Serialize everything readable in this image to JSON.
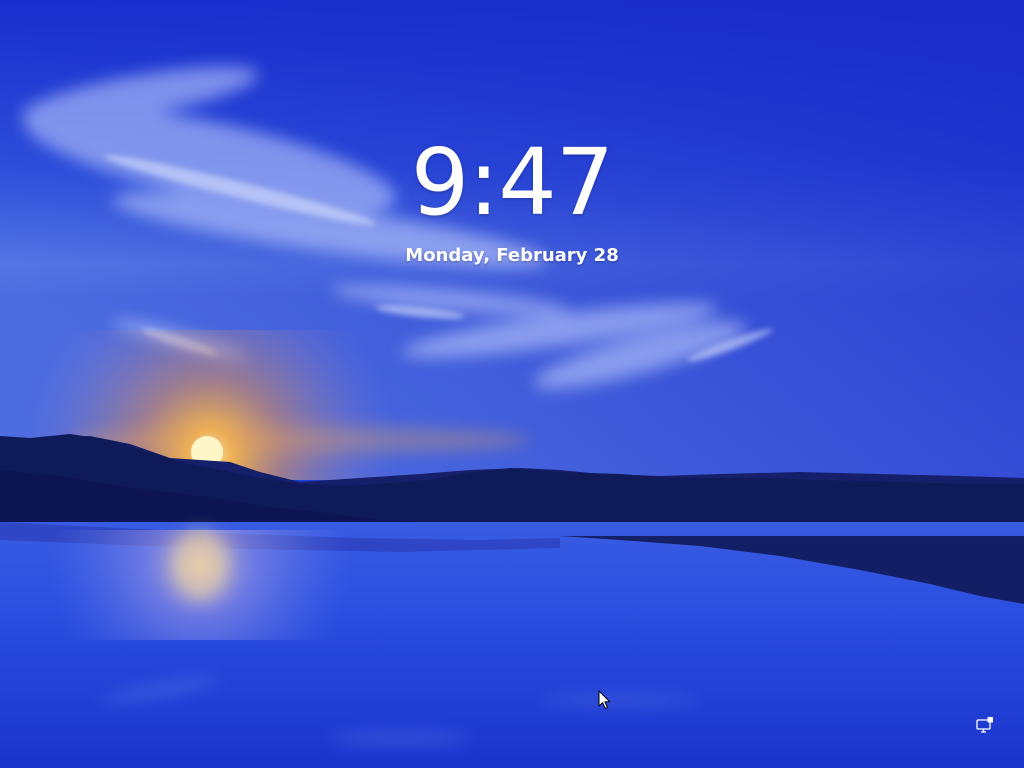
{
  "lock_screen": {
    "time": "9:47",
    "date": "Monday, February 28"
  },
  "system_tray": {
    "network_icon": "network-monitor-icon"
  },
  "pointer": {
    "icon": "mouse-pointer-icon"
  },
  "colors": {
    "sky_top": "#1d36d4",
    "sky_mid": "#3f63e0",
    "horizon_glow": "#f6a93c",
    "hills": "#111b55",
    "water": "#2a4de0",
    "text": "#ffffff"
  }
}
